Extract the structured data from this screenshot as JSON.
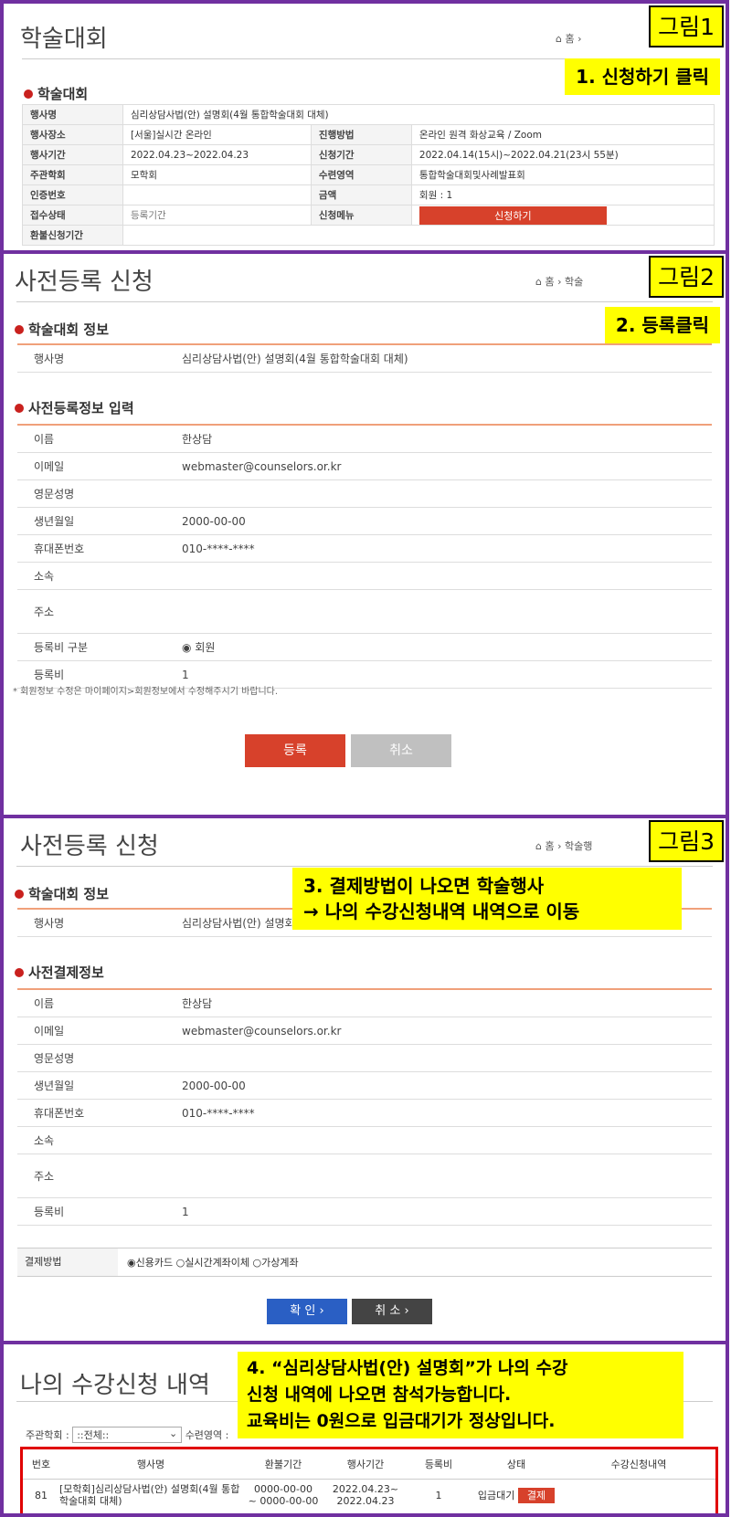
{
  "panel1": {
    "page_title": "학술대회",
    "breadcrumb_home": "홈",
    "figure_label": "그림1",
    "callout": "1. 신청하기 클릭",
    "section_title": "학술대회",
    "event_name_label": "행사명",
    "event_name": "심리상담사법(안) 설명회(4월 통합학술대회 대체)",
    "place_label": "행사장소",
    "place": "[서울]실시간 온라인",
    "method_label": "진행방법",
    "method": "온라인 원격 화상교육 / Zoom",
    "period_label": "행사기간",
    "period": "2022.04.23~2022.04.23",
    "apply_period_label": "신청기간",
    "apply_period": "2022.04.14(15시)~2022.04.21(23시 55분)",
    "host_label": "주관학회",
    "host": "모학회",
    "training_label": "수련영역",
    "training": "통합학술대회및사례발표회",
    "cert_label": "인증번호",
    "cert": "",
    "fee_label": "금액",
    "fee": "회원 : 1",
    "status_label": "접수상태",
    "status": "등록기간",
    "apply_menu_label": "신청메뉴",
    "apply_button": "신청하기",
    "refund_label": "환불신청기간",
    "refund": ""
  },
  "panel2": {
    "page_title": "사전등록 신청",
    "breadcrumb_home": "홈",
    "breadcrumb_next": "학술",
    "figure_label": "그림2",
    "callout": "2. 등록클릭",
    "info_section": "학술대회 정보",
    "event_name_label": "행사명",
    "event_name": "심리상담사법(안) 설명회(4월 통합학술대회 대체)",
    "input_section": "사전등록정보 입력",
    "fields": {
      "name_label": "이름",
      "name": "한상담",
      "email_label": "이메일",
      "email": "webmaster@counselors.or.kr",
      "eng_label": "영문성명",
      "eng": "",
      "birth_label": "생년월일",
      "birth": "2000-00-00",
      "phone_label": "휴대폰번호",
      "phone": "010-****-****",
      "org_label": "소속",
      "org": "",
      "addr_label": "주소",
      "addr": "",
      "feetype_label": "등록비 구분",
      "feetype": "회원",
      "fee_label": "등록비",
      "fee": "1"
    },
    "note": "* 회원정보 수정은 마이페이지>회원정보에서 수정해주시기 바랍니다.",
    "register_button": "등록",
    "cancel_button": "취소"
  },
  "panel3": {
    "page_title": "사전등록 신청",
    "breadcrumb_home": "홈",
    "breadcrumb_next": "학술행",
    "figure_label": "그림3",
    "callout_line1": "3. 결제방법이 나오면 학술행사",
    "callout_line2": "→ 나의 수강신청내역 내역으로 이동",
    "info_section": "학술대회 정보",
    "event_name_label": "행사명",
    "event_name": "심리상담사법(안) 설명회(",
    "pay_section": "사전결제정보",
    "fields": {
      "name_label": "이름",
      "name": "한상담",
      "email_label": "이메일",
      "email": "webmaster@counselors.or.kr",
      "eng_label": "영문성명",
      "eng": "",
      "birth_label": "생년월일",
      "birth": "2000-00-00",
      "phone_label": "휴대폰번호",
      "phone": "010-****-****",
      "org_label": "소속",
      "org": "",
      "addr_label": "주소",
      "addr": "",
      "fee_label": "등록비",
      "fee": "1"
    },
    "pay_method_label": "결제방법",
    "pay_options": [
      "신용카드",
      "실시간계좌이체",
      "가상계좌"
    ],
    "confirm_button": "확 인",
    "cancel_button": "취 소"
  },
  "panel4": {
    "page_title": "나의 수강신청 내역",
    "callout_line1": "4. “심리상담사법(안) 설명회”가 나의 수강",
    "callout_line2": "신청 내역에 나오면 참석가능합니다.",
    "callout_line3": "교육비는 0원으로 입금대기가 정상입니다.",
    "filter_host_label": "주관학회 :",
    "filter_host_value": "::전체::",
    "filter_training_label": "수련영역 :",
    "columns": [
      "번호",
      "행사명",
      "환불기간",
      "행사기간",
      "등록비",
      "상태",
      "수강신청내역"
    ],
    "row": {
      "no": "81",
      "name": "[모학회]심리상담사법(안) 설명회(4월 통합학술대회 대체)",
      "refund_1": "0000-00-00",
      "refund_2": "~ 0000-00-00",
      "period_1": "2022.04.23~",
      "period_2": "2022.04.23",
      "fee": "1",
      "status": "입금대기",
      "pay_button": "결제"
    }
  },
  "colors": {
    "frame": "#7030a0",
    "callout": "#ffff00",
    "accent_red": "#d7412b",
    "confirm_blue": "#2a5fc4"
  }
}
